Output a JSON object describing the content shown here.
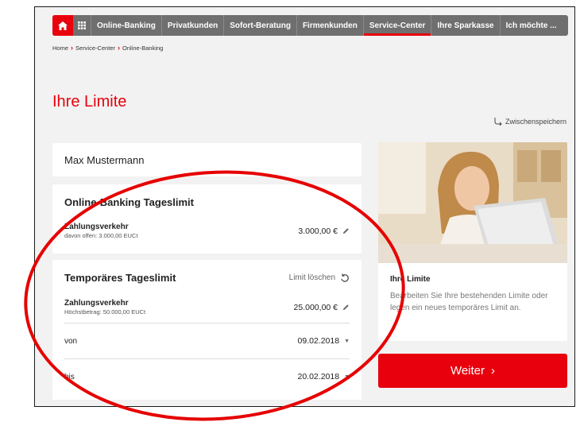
{
  "nav": {
    "items": [
      {
        "label": "Online-Banking",
        "active": false
      },
      {
        "label": "Privatkunden",
        "active": false
      },
      {
        "label": "Sofort-Beratung",
        "active": false
      },
      {
        "label": "Firmenkunden",
        "active": false
      },
      {
        "label": "Service-Center",
        "active": true
      },
      {
        "label": "Ihre Sparkasse",
        "active": false
      },
      {
        "label": "Ich möchte ...",
        "active": false
      }
    ]
  },
  "breadcrumb": [
    "Home",
    "Service-Center",
    "Online-Banking"
  ],
  "page": {
    "title": "Ihre Limite",
    "save_label": "Zwischenspeichern"
  },
  "account": {
    "name": "Max Mustermann"
  },
  "online_banking_limit": {
    "title": "Online-Banking Tageslimit",
    "label": "Zahlungsverkehr",
    "sub": "davon offen: 3.000,00 EUCt",
    "value": "3.000,00 €"
  },
  "temp_limit": {
    "title": "Temporäres Tageslimit",
    "delete_label": "Limit löschen",
    "label": "Zahlungsverkehr",
    "sub": "Höchstbetrag: 50.000,00 EUCt",
    "value": "25.000,00 €",
    "from_label": "von",
    "from_value": "09.02.2018",
    "to_label": "bis",
    "to_value": "20.02.2018"
  },
  "info": {
    "title": "Ihre Limite",
    "text": "Bearbeiten Sie Ihre bestehenden Limite oder legen ein neues temporäres Limit an."
  },
  "next_button": {
    "label": "Weiter"
  },
  "colors": {
    "brand_red": "#e8000c",
    "nav_gray": "#6f6f6f",
    "annotation_red": "#e60000"
  }
}
